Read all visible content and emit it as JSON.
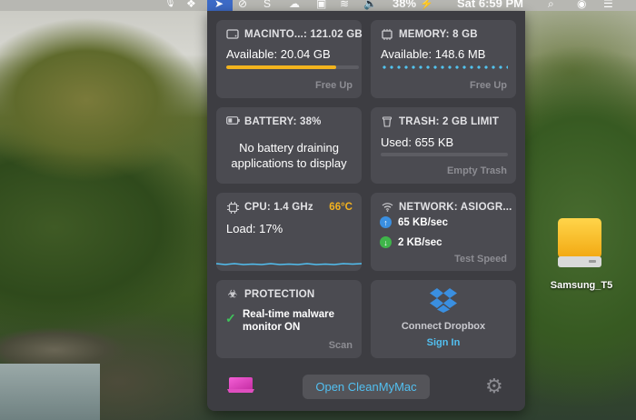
{
  "menubar": {
    "percent": "38%",
    "clock": "Sat 6:59 PM"
  },
  "panel": {
    "disk": {
      "title": "MACINTO...: 121.02 GB",
      "available": "Available: 20.04 GB",
      "used_fraction": 0.83,
      "action": "Free Up"
    },
    "memory": {
      "title": "MEMORY: 8 GB",
      "available": "Available: 148.6 MB",
      "action": "Free Up"
    },
    "battery": {
      "title": "BATTERY: 38%",
      "message_line1": "No battery draining",
      "message_line2": "applications to display"
    },
    "trash": {
      "title": "TRASH: 2 GB LIMIT",
      "used": "Used: 655 KB",
      "action": "Empty Trash"
    },
    "cpu": {
      "title": "CPU: 1.4 GHz",
      "temperature": "66°C",
      "load": "Load: 17%"
    },
    "network": {
      "title": "NETWORK: ASIOGR...",
      "upload": "65 KB/sec",
      "download": "2 KB/sec",
      "action": "Test Speed"
    },
    "protection": {
      "title": "PROTECTION",
      "line1": "Real-time malware",
      "line2": "monitor ON",
      "action": "Scan"
    },
    "dropbox": {
      "label": "Connect Dropbox",
      "action": "Sign In"
    },
    "footer": {
      "open_label": "Open CleanMyMac"
    }
  },
  "desktop": {
    "drive_label": "Samsung_T5"
  },
  "colors": {
    "accent_blue": "#52bff0",
    "disk_bar": "#f2b31d",
    "temp": "#f3b21f",
    "ok_green": "#3fc35a"
  }
}
